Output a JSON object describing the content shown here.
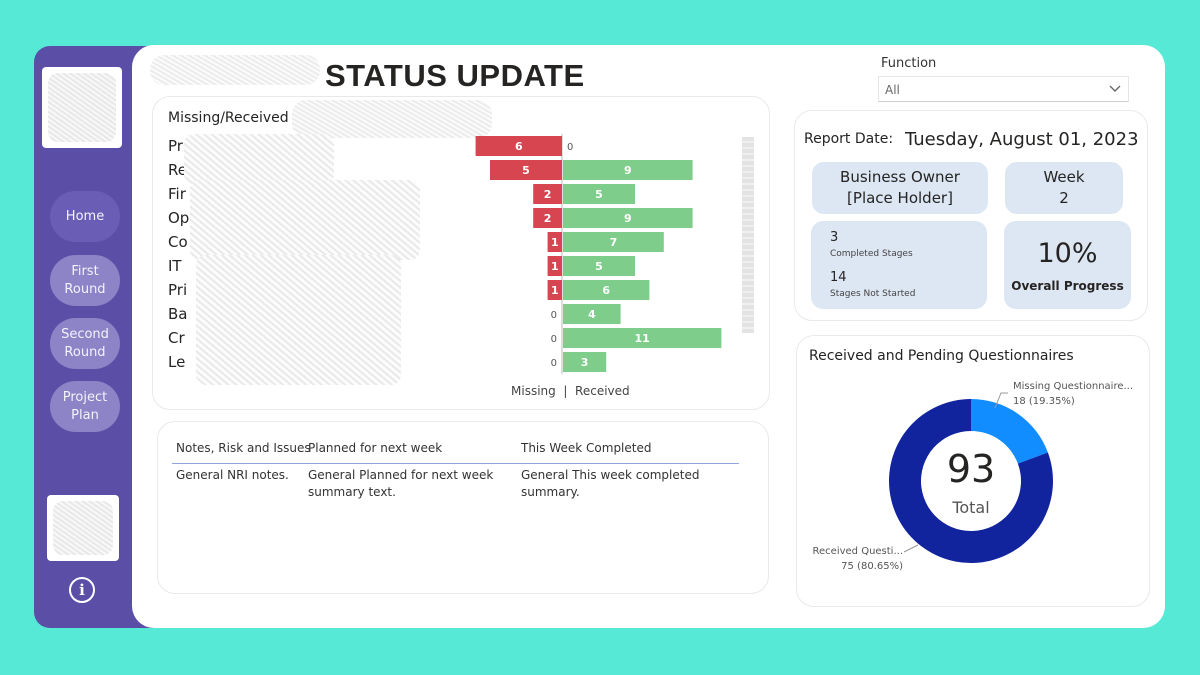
{
  "header": {
    "title": "STATUS UPDATE"
  },
  "sidebar": {
    "buttons": [
      {
        "label": "Home"
      },
      {
        "label": "First\nRound"
      },
      {
        "label": "Second\nRound"
      },
      {
        "label": "Project\nPlan"
      }
    ],
    "info_icon": "info-icon"
  },
  "filter": {
    "label": "Function",
    "value": "All"
  },
  "missing_received": {
    "title": "Missing/Received",
    "category_fragments": [
      "Pr",
      "Re",
      "Fir",
      "Op",
      "Co",
      "IT",
      "Pri",
      "Ba",
      "Cr",
      "Le"
    ],
    "axis_legend": "Missing  |  Received"
  },
  "chart_data": {
    "type": "bar",
    "orientation": "horizontal-diverging",
    "categories": [
      "Pr",
      "Re",
      "Fir",
      "Op",
      "Co",
      "IT",
      "Pri",
      "Ba",
      "Cr",
      "Le"
    ],
    "series": [
      {
        "name": "Missing",
        "color": "#d64550",
        "values": [
          6,
          5,
          2,
          2,
          1,
          1,
          1,
          0,
          0,
          0
        ]
      },
      {
        "name": "Received",
        "color": "#7fcd8b",
        "values": [
          0,
          9,
          5,
          9,
          7,
          5,
          6,
          4,
          11,
          3
        ]
      }
    ],
    "xlabel": "Missing  |  Received"
  },
  "notes": {
    "columns": [
      "Notes, Risk and Issues",
      "Planned for next week",
      "This Week Completed"
    ],
    "row": [
      "General NRI notes.",
      "General Planned for next week summary text.",
      "General This week completed summary."
    ]
  },
  "report": {
    "date_label": "Report Date:",
    "date_value": "Tuesday, August 01, 2023",
    "owner_label": "Business Owner",
    "owner_value": "[Place Holder]",
    "week_label": "Week",
    "week_value": "2",
    "completed_count": "3",
    "completed_label": "Completed Stages",
    "not_started_count": "14",
    "not_started_label": "Stages Not Started",
    "progress_value": "10%",
    "progress_label": "Overall Progress"
  },
  "questionnaires": {
    "title": "Received and Pending Questionnaires",
    "total": "93",
    "total_label": "Total",
    "missing_label": "Missing Questionnaire...",
    "missing_detail": "18 (19.35%)",
    "received_label": "Received Questi...",
    "received_detail": "75 (80.65%)",
    "slices": [
      {
        "value": 18,
        "color": "#118dff"
      },
      {
        "value": 75,
        "color": "#12239e"
      }
    ]
  }
}
